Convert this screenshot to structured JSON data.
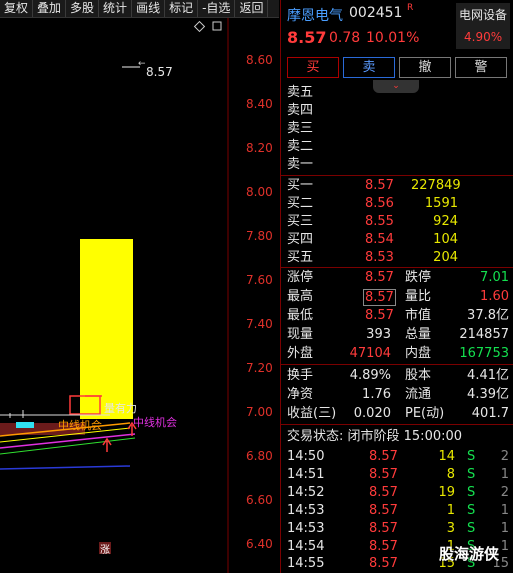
{
  "toolbar": [
    "复权",
    "叠加",
    "多股",
    "统计",
    "画线",
    "标记",
    "-自选",
    "返回"
  ],
  "chart": {
    "price_ticks": [
      "8.60",
      "8.40",
      "8.20",
      "8.00",
      "7.80",
      "7.60",
      "7.40",
      "7.20",
      "7.00",
      "6.80",
      "6.60",
      "6.40"
    ],
    "annotation_high": "8.57",
    "label_volume": "量有力",
    "label_mid_opportunity": "中线机会",
    "label_mid_opportunity2": "中线机会",
    "label_rise": "涨"
  },
  "stock": {
    "name": "摩恩电气",
    "code": "002451",
    "badge": "R",
    "price": "8.57",
    "change": "0.78",
    "change_pct": "10.01%",
    "sector": "电网设备",
    "sector_pct": "4.90%"
  },
  "buttons": {
    "buy": "买",
    "sell": "卖",
    "cancel": "撤",
    "alert": "警"
  },
  "sell_levels": [
    {
      "label": "卖五",
      "price": "",
      "vol": ""
    },
    {
      "label": "卖四",
      "price": "",
      "vol": ""
    },
    {
      "label": "卖三",
      "price": "",
      "vol": ""
    },
    {
      "label": "卖二",
      "price": "",
      "vol": ""
    },
    {
      "label": "卖一",
      "price": "",
      "vol": ""
    }
  ],
  "buy_levels": [
    {
      "label": "买一",
      "price": "8.57",
      "vol": "227849"
    },
    {
      "label": "买二",
      "price": "8.56",
      "vol": "1591"
    },
    {
      "label": "买三",
      "price": "8.55",
      "vol": "924"
    },
    {
      "label": "买四",
      "price": "8.54",
      "vol": "104"
    },
    {
      "label": "买五",
      "price": "8.53",
      "vol": "204"
    }
  ],
  "stats": {
    "limit_up_label": "涨停",
    "limit_up": "8.57",
    "limit_down_label": "跌停",
    "limit_down": "7.01",
    "high_label": "最高",
    "high": "8.57",
    "vol_ratio_label": "量比",
    "vol_ratio": "1.60",
    "low_label": "最低",
    "low": "8.57",
    "mktcap_label": "市值",
    "mktcap": "37.8亿",
    "cur_label": "现量",
    "cur": "393",
    "total_label": "总量",
    "total": "214857",
    "outer_label": "外盘",
    "outer": "47104",
    "inner_label": "内盘",
    "inner": "167753",
    "turnover_label": "换手",
    "turnover": "4.89%",
    "equity_label": "股本",
    "equity": "4.41亿",
    "nav_label": "净资",
    "nav": "1.76",
    "float_label": "流通",
    "float": "4.39亿",
    "eps_label": "收益(三)",
    "eps": "0.020",
    "pe_label": "PE(动)",
    "pe": "401.7"
  },
  "trade_status": "交易状态: 闭市阶段 15:00:00",
  "ticks": [
    {
      "time": "14:50",
      "price": "8.57",
      "vol": "14",
      "dir": "S",
      "n": "2"
    },
    {
      "time": "14:51",
      "price": "8.57",
      "vol": "8",
      "dir": "S",
      "n": "1"
    },
    {
      "time": "14:52",
      "price": "8.57",
      "vol": "19",
      "dir": "S",
      "n": "2"
    },
    {
      "time": "14:53",
      "price": "8.57",
      "vol": "1",
      "dir": "S",
      "n": "1"
    },
    {
      "time": "14:53",
      "price": "8.57",
      "vol": "3",
      "dir": "S",
      "n": "1"
    },
    {
      "time": "14:54",
      "price": "8.57",
      "vol": "1",
      "dir": "S",
      "n": "1"
    },
    {
      "time": "14:55",
      "price": "8.57",
      "vol": "15",
      "dir": "S",
      "n": "15"
    }
  ],
  "watermark": "股海游侠"
}
